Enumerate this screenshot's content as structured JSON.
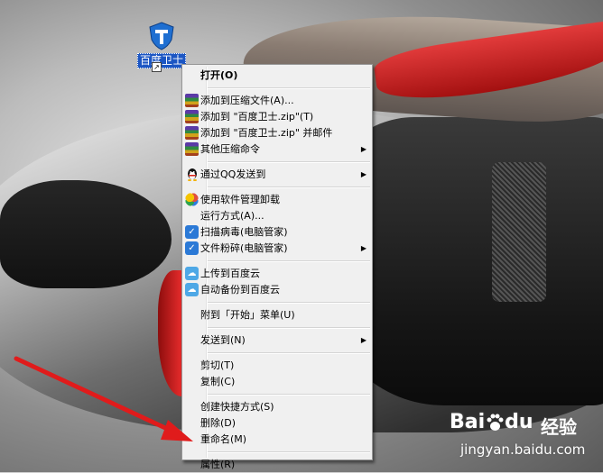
{
  "desktop_icon": {
    "label": "百度卫士",
    "icon": "baidu-guard-shield-icon",
    "shortcut_overlay": "↗"
  },
  "context_menu": {
    "items": [
      {
        "label": "打开(O)",
        "icon": "",
        "bold": true,
        "submenu": false
      },
      {
        "separator": true
      },
      {
        "label": "添加到压缩文件(A)...",
        "icon": "winrar-icon",
        "submenu": false
      },
      {
        "label": "添加到 \"百度卫士.zip\"(T)",
        "icon": "winrar-icon",
        "submenu": false
      },
      {
        "label": "添加到 \"百度卫士.zip\" 并邮件",
        "icon": "winrar-icon",
        "submenu": false
      },
      {
        "label": "其他压缩命令",
        "icon": "winrar-icon",
        "submenu": true
      },
      {
        "separator": true
      },
      {
        "label": "通过QQ发送到",
        "icon": "qq-penguin-icon",
        "submenu": true
      },
      {
        "separator": true
      },
      {
        "label": "使用软件管理卸载",
        "icon": "software-manager-icon",
        "submenu": false
      },
      {
        "label": "运行方式(A)...",
        "icon": "",
        "submenu": false
      },
      {
        "label": "扫描病毒(电脑管家)",
        "icon": "pc-manager-shield-icon",
        "submenu": false
      },
      {
        "label": "文件粉碎(电脑管家)",
        "icon": "pc-manager-shield-icon",
        "submenu": true
      },
      {
        "separator": true
      },
      {
        "label": "上传到百度云",
        "icon": "baidu-cloud-icon",
        "submenu": false
      },
      {
        "label": "自动备份到百度云",
        "icon": "baidu-cloud-icon",
        "submenu": false
      },
      {
        "separator": true
      },
      {
        "label": "附到「开始」菜单(U)",
        "icon": "",
        "submenu": false
      },
      {
        "separator": true
      },
      {
        "label": "发送到(N)",
        "icon": "",
        "submenu": true
      },
      {
        "separator": true
      },
      {
        "label": "剪切(T)",
        "icon": "",
        "submenu": false
      },
      {
        "label": "复制(C)",
        "icon": "",
        "submenu": false
      },
      {
        "separator": true
      },
      {
        "label": "创建快捷方式(S)",
        "icon": "",
        "submenu": false
      },
      {
        "label": "删除(D)",
        "icon": "",
        "submenu": false
      },
      {
        "label": "重命名(M)",
        "icon": "",
        "submenu": false
      },
      {
        "separator": true
      },
      {
        "label": "属性(R)",
        "icon": "",
        "submenu": false
      }
    ]
  },
  "watermark": {
    "logo_text": "Bai",
    "logo_text_end": "du",
    "cn_text": "经验",
    "url": "jingyan.baidu.com"
  },
  "colors": {
    "menu_bg": "#f0f0f0",
    "selection_label_bg": "#1c56c3",
    "arrow": "#e01b1b"
  }
}
